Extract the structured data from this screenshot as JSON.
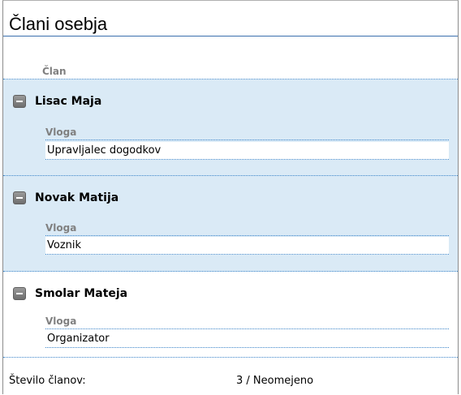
{
  "panel": {
    "title": "Člani osebja",
    "column_header": "Član"
  },
  "members": [
    {
      "name": "Lisac Maja",
      "role_label": "Vloga",
      "role": "Upravljalec dogodkov"
    },
    {
      "name": "Novak Matija",
      "role_label": "Vloga",
      "role": "Voznik"
    },
    {
      "name": "Smolar Mateja",
      "role_label": "Vloga",
      "role": "Organizator"
    }
  ],
  "footer": {
    "count_label": "Število članov:",
    "count_value": "3 / Neomejeno"
  },
  "colors": {
    "highlight_row": "#daeaf6",
    "divider": "#3b84c9",
    "muted_label": "#808080"
  },
  "icons": {
    "collapse": "minus-box-icon"
  }
}
